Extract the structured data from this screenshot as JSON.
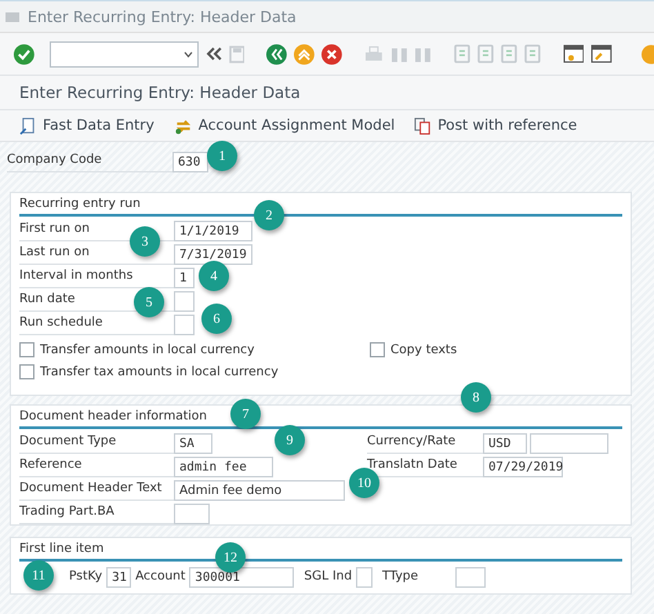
{
  "window": {
    "title": "Enter Recurring Entry: Header Data"
  },
  "screen_title": "Enter Recurring Entry: Header Data",
  "app_toolbar": [
    {
      "label": "Fast Data Entry",
      "kind": "fast"
    },
    {
      "label": "Account Assignment Model",
      "kind": "model"
    },
    {
      "label": "Post with reference",
      "kind": "reference"
    }
  ],
  "company_code": {
    "label": "Company Code",
    "value": "630"
  },
  "recurring_run": {
    "title": "Recurring entry run",
    "fields": [
      {
        "label": "First run on",
        "value": "1/1/2019"
      },
      {
        "label": "Last run on",
        "value": "7/31/2019"
      },
      {
        "label": "Interval in months",
        "value": "1"
      },
      {
        "label": "Run date"
      },
      {
        "label": "Run schedule"
      }
    ],
    "checkboxes": [
      {
        "label": "Transfer amounts in local currency",
        "checked": false
      },
      {
        "label": "Copy texts",
        "checked": false
      },
      {
        "label": "Transfer tax amounts in local currency",
        "checked": false
      }
    ]
  },
  "document_header": {
    "title": "Document header information",
    "left_fields": [
      {
        "label": "Document Type",
        "value": "SA"
      },
      {
        "label": "Reference",
        "value": "admin fee"
      },
      {
        "label": "Document Header Text",
        "value": "Admin fee demo"
      },
      {
        "label": "Trading Part.BA"
      }
    ],
    "right_fields": [
      {
        "label": "Currency/Rate",
        "value": "USD",
        "kind": "pair"
      },
      {
        "label": "Translatn Date",
        "value": "07/29/2019",
        "kind": "single"
      }
    ]
  },
  "first_line_item": {
    "title": "First line item",
    "fields": [
      {
        "label": "PstKy",
        "value": "31"
      },
      {
        "label": "Account",
        "value": "300001"
      },
      {
        "label": "SGL Ind"
      },
      {
        "label": "TType"
      }
    ]
  },
  "callouts": [
    "1",
    "2",
    "3",
    "4",
    "5",
    "6",
    "7",
    "8",
    "9",
    "10",
    "11",
    "12"
  ]
}
